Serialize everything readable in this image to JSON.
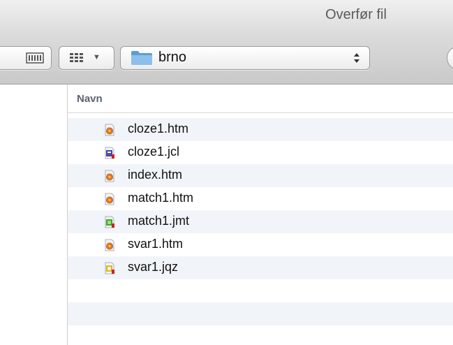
{
  "window": {
    "title": "Overfør fil"
  },
  "toolbar": {
    "path": "brno",
    "columns_view_icon": "columns-view-icon",
    "arrange_icon": "grid-view-icon"
  },
  "list": {
    "header": "Navn",
    "files": [
      {
        "name": "cloze1.htm",
        "icon": "html-file-icon"
      },
      {
        "name": "cloze1.jcl",
        "icon": "jcloze-file-icon"
      },
      {
        "name": "index.htm",
        "icon": "html-file-icon"
      },
      {
        "name": "match1.htm",
        "icon": "html-file-icon"
      },
      {
        "name": "match1.jmt",
        "icon": "jmatch-file-icon"
      },
      {
        "name": "svar1.htm",
        "icon": "html-file-icon"
      },
      {
        "name": "svar1.jqz",
        "icon": "jquiz-file-icon"
      }
    ]
  },
  "colors": {
    "row_alt": "#f1f5fa",
    "folder_blue": "#6aa6d8",
    "header_text": "#5b6370"
  }
}
